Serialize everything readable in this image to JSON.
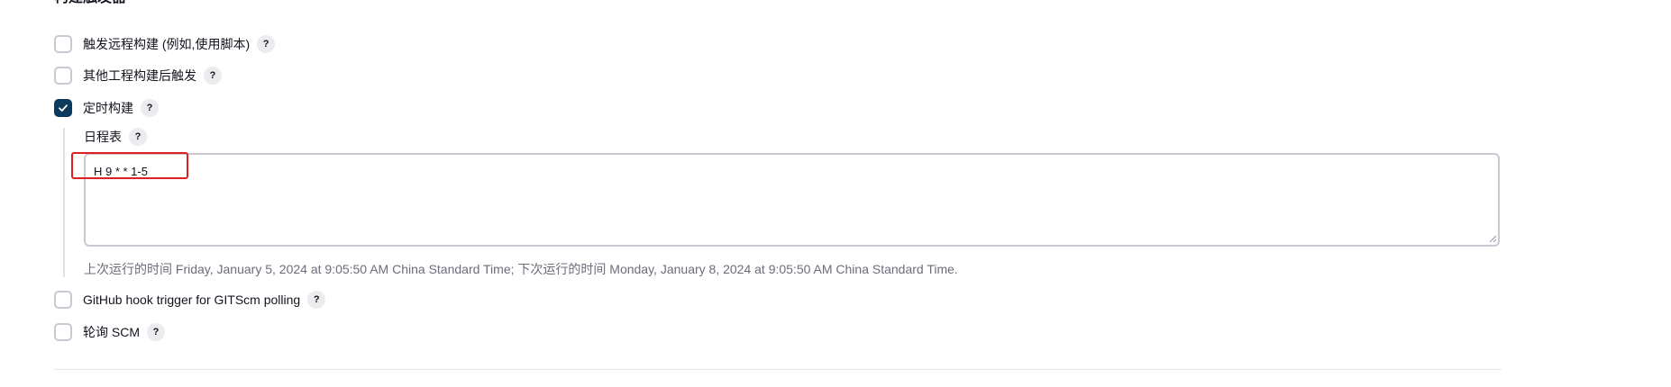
{
  "section": {
    "title": "构建触发器"
  },
  "triggers": [
    {
      "label": "触发远程构建 (例如,使用脚本)",
      "checked": false,
      "help": "?"
    },
    {
      "label": "其他工程构建后触发",
      "checked": false,
      "help": "?"
    },
    {
      "label": "定时构建",
      "checked": true,
      "help": "?"
    },
    {
      "label": "GitHub hook trigger for GITScm polling",
      "checked": false,
      "help": "?"
    },
    {
      "label": "轮询 SCM",
      "checked": false,
      "help": "?"
    }
  ],
  "schedule": {
    "label": "日程表",
    "help": "?",
    "value": "H 9 * * 1-5",
    "hint": "上次运行的时间 Friday, January 5, 2024 at 9:05:50 AM China Standard Time; 下次运行的时间 Monday, January 8, 2024 at 9:05:50 AM China Standard Time."
  },
  "colors": {
    "checkbox_checked": "#0b3a5c",
    "highlight": "#e02020",
    "hint_text": "#6d6d7a"
  }
}
